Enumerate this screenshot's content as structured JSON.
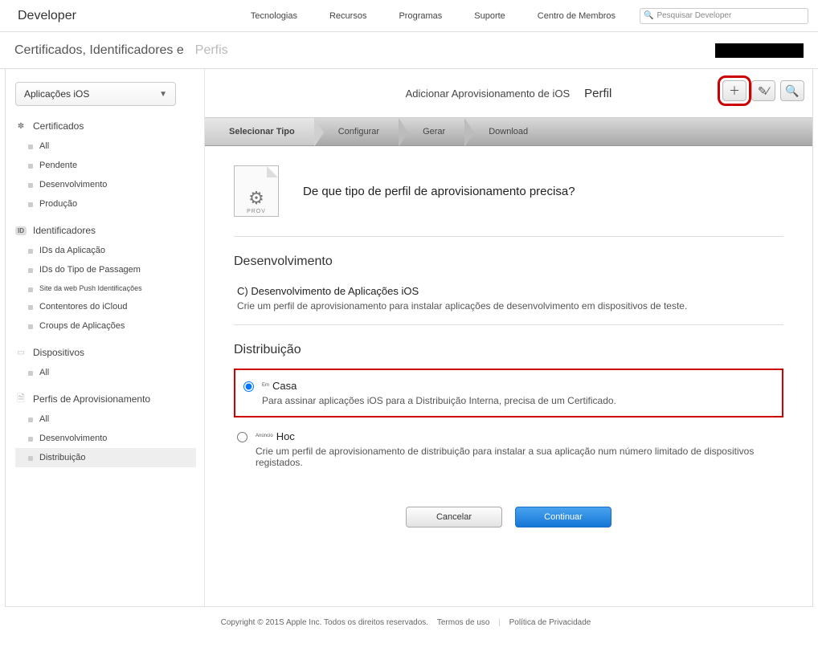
{
  "topnav": {
    "title": "Developer",
    "menu": [
      "Tecnologias",
      "Recursos",
      "Programas",
      "Suporte",
      "Centro de Membros"
    ],
    "search_placeholder": "Pesquisar Developer"
  },
  "breadcrumb": {
    "main": "Certificados, Identificadores e",
    "suffix": "Perfis"
  },
  "sidebar": {
    "platform": "Aplicações iOS",
    "sections": [
      {
        "title": "Certificados",
        "items": [
          "All",
          "Pendente",
          "Desenvolvimento",
          "Produção"
        ]
      },
      {
        "title": "Identificadores",
        "items": [
          "IDs da Aplicação",
          "IDs do Tipo de Passagem",
          "Site da web Push Identificações",
          "Contentores do iCloud",
          "Croups de Aplicações"
        ]
      },
      {
        "title": "Dispositivos",
        "items": [
          "All"
        ]
      },
      {
        "title": "Perfis de Aprovisionamento",
        "items": [
          "All",
          "Desenvolvimento",
          "Distribuição"
        ]
      }
    ]
  },
  "content": {
    "header_prefix": "Adicionar Aprovisionamento de iOS",
    "header_suffix": "Perfil",
    "provfile_label": "PROV",
    "steps": [
      "Selecionar Tipo",
      "Configurar",
      "Gerar",
      "Download"
    ],
    "question": "De que tipo de perfil de aprovisionamento precisa?",
    "dev_section": {
      "title": "Desenvolvimento",
      "opt_label": "C) Desenvolvimento de Aplicações iOS",
      "opt_desc": "Crie um perfil de aprovisionamento para instalar aplicações de desenvolvimento em dispositivos de teste."
    },
    "dist_section": {
      "title": "Distribuição",
      "opt1_sup": "Em",
      "opt1_label": "Casa",
      "opt1_desc": "Para assinar aplicações iOS para a Distribuição Interna, precisa de um Certificado.",
      "opt2_sup": "Anúncio",
      "opt2_label": "Hoc",
      "opt2_desc": "Crie um perfil de aprovisionamento de distribuição para instalar a sua aplicação num número limitado de dispositivos registados."
    },
    "buttons": {
      "cancel": "Cancelar",
      "continue": "Continuar"
    }
  },
  "footer": {
    "copyright": "Copyright © 201S Apple Inc. Todos os direitos reservados.",
    "terms": "Termos de uso",
    "privacy": "Política de Privacidade"
  }
}
